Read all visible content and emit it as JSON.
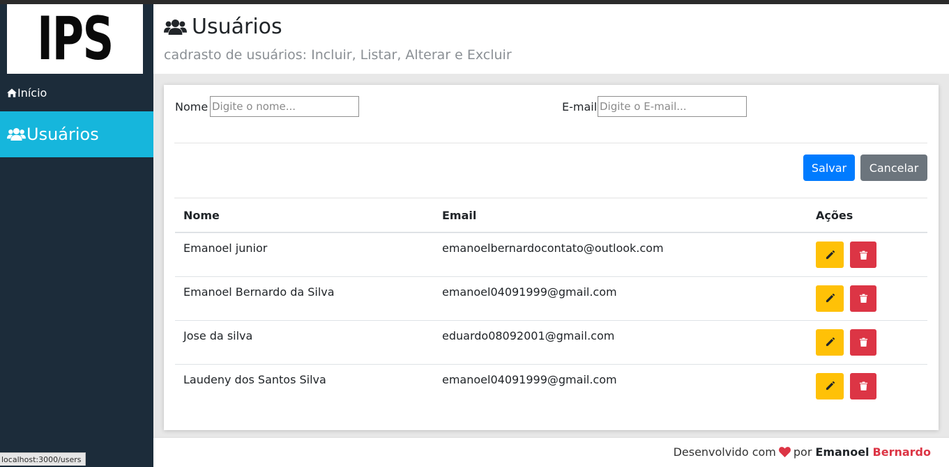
{
  "sidebar": {
    "logo_text": "IPS",
    "items": [
      {
        "label": "Início",
        "icon": "home-icon"
      },
      {
        "label": "Usuários",
        "icon": "users-icon",
        "active": true
      }
    ],
    "status_url": "localhost:3000/users"
  },
  "header": {
    "title": "Usuários",
    "subtitle": "cadrasto de usuários: Incluir, Listar, Alterar e Excluir"
  },
  "form": {
    "name_label": "Nome",
    "name_placeholder": "Digite o nome...",
    "email_label": "E-mail",
    "email_placeholder": "Digite o E-mail...",
    "save_label": "Salvar",
    "cancel_label": "Cancelar"
  },
  "table": {
    "columns": [
      "Nome",
      "Email",
      "Ações"
    ],
    "rows": [
      {
        "name": "Emanoel junior",
        "email": "emanoelbernardocontato@outlook.com"
      },
      {
        "name": "Emanoel Bernardo da Silva",
        "email": "emanoel04091999@gmail.com"
      },
      {
        "name": "Jose da silva",
        "email": "eduardo08092001@gmail.com"
      },
      {
        "name": "Laudeny dos Santos Silva",
        "email": "emanoel04091999@gmail.com"
      }
    ]
  },
  "footer": {
    "prefix": "Desenvolvido com",
    "middle": "por",
    "author_first": "Emanoel",
    "author_last": "Bernardo"
  },
  "colors": {
    "sidebar_bg": "#1c2c3a",
    "active_item": "#16b6dc",
    "primary": "#007bff",
    "secondary": "#6c757d",
    "warning": "#ffc107",
    "danger": "#dc3545"
  }
}
